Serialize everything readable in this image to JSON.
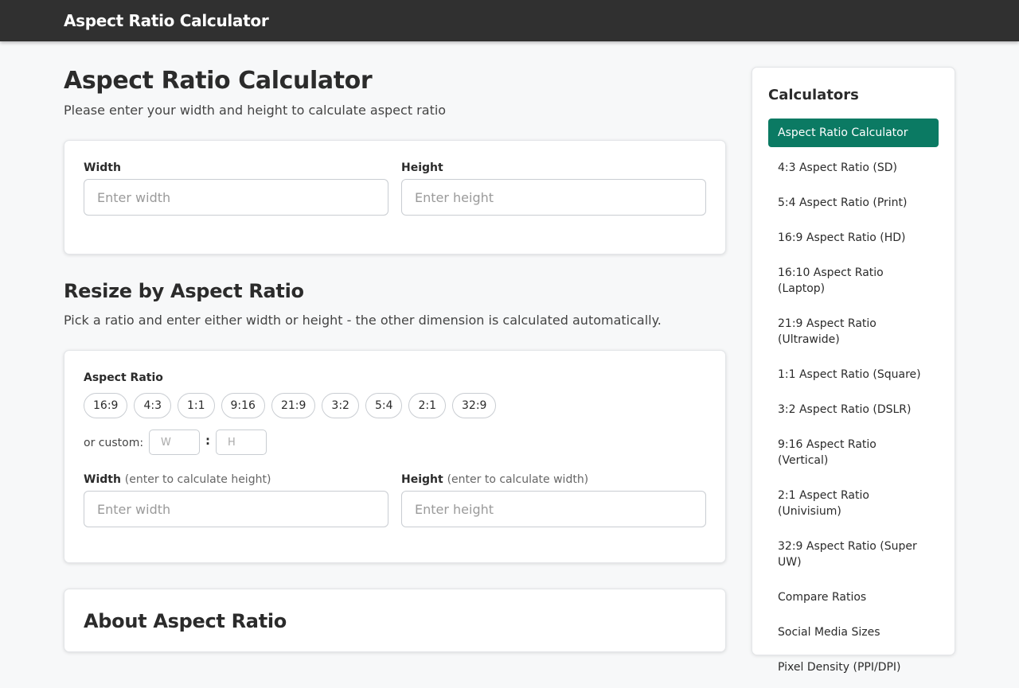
{
  "header": {
    "brand": "Aspect Ratio Calculator"
  },
  "calculator": {
    "title": "Aspect Ratio Calculator",
    "subtitle": "Please enter your width and height to calculate aspect ratio",
    "width_label": "Width",
    "width_placeholder": "Enter width",
    "height_label": "Height",
    "height_placeholder": "Enter height"
  },
  "resize": {
    "title": "Resize by Aspect Ratio",
    "subtitle": "Pick a ratio and enter either width or height - the other dimension is calculated automatically.",
    "ratio_label": "Aspect Ratio",
    "ratios": [
      "16:9",
      "4:3",
      "1:1",
      "9:16",
      "21:9",
      "3:2",
      "5:4",
      "2:1",
      "32:9"
    ],
    "custom_label": "or custom:",
    "custom_w_placeholder": "W",
    "custom_separator": ":",
    "custom_h_placeholder": "H",
    "width_label": "Width",
    "width_hint": "(enter to calculate height)",
    "width_placeholder": "Enter width",
    "height_label": "Height",
    "height_hint": "(enter to calculate width)",
    "height_placeholder": "Enter height"
  },
  "about": {
    "title": "About Aspect Ratio"
  },
  "sidebar": {
    "title": "Calculators",
    "items": [
      {
        "label": "Aspect Ratio Calculator",
        "active": true
      },
      {
        "label": "4:3 Aspect Ratio (SD)"
      },
      {
        "label": "5:4 Aspect Ratio (Print)"
      },
      {
        "label": "16:9 Aspect Ratio (HD)"
      },
      {
        "label": "16:10 Aspect Ratio (Laptop)"
      },
      {
        "label": "21:9 Aspect Ratio (Ultrawide)"
      },
      {
        "label": "1:1 Aspect Ratio (Square)"
      },
      {
        "label": "3:2 Aspect Ratio (DSLR)"
      },
      {
        "label": "9:16 Aspect Ratio (Vertical)"
      },
      {
        "label": "2:1 Aspect Ratio (Univisium)"
      },
      {
        "label": "32:9 Aspect Ratio (Super UW)"
      },
      {
        "label": "Compare Ratios"
      },
      {
        "label": "Social Media Sizes"
      },
      {
        "label": "Pixel Density (PPI/DPI)"
      }
    ]
  },
  "colors": {
    "topbar": "#303030",
    "accent": "#0b7a63",
    "background": "#f7f8f9"
  }
}
